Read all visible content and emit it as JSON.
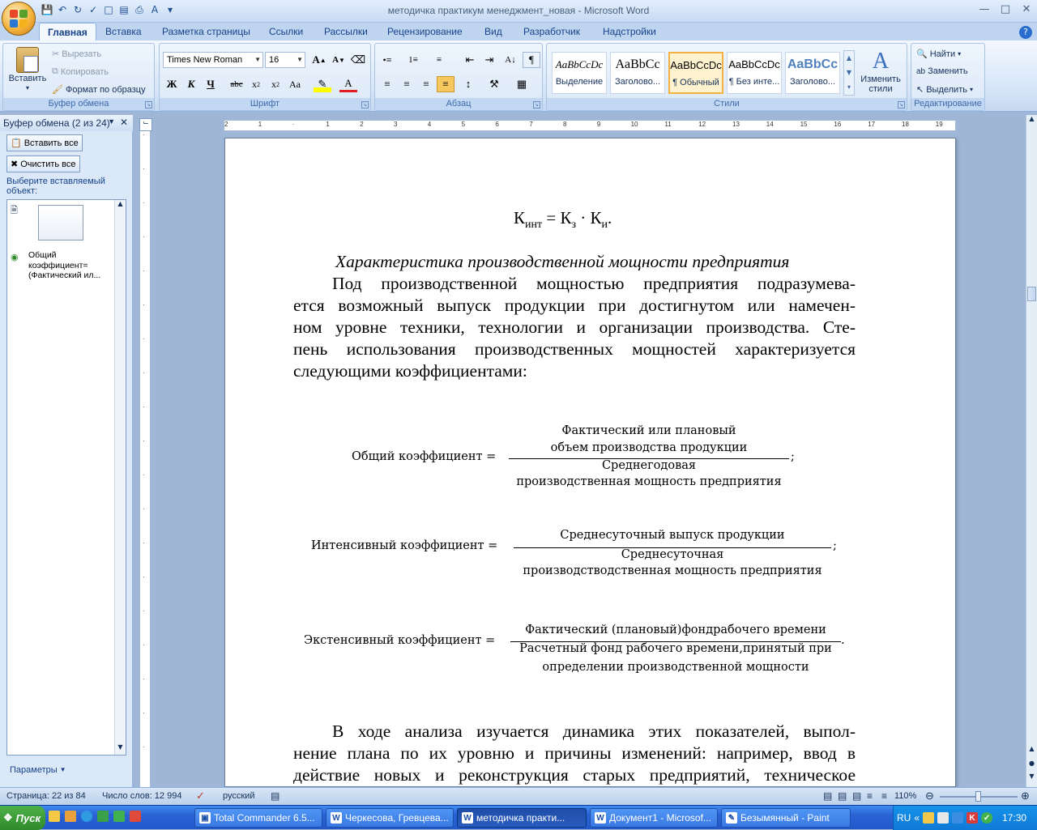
{
  "window": {
    "title": "методичка практикум менеджмент_новая - Microsoft Word"
  },
  "tabs": [
    "Главная",
    "Вставка",
    "Разметка страницы",
    "Ссылки",
    "Рассылки",
    "Рецензирование",
    "Вид",
    "Разработчик",
    "Надстройки"
  ],
  "ribbon": {
    "clipboard": {
      "label": "Буфер обмена",
      "paste": "Вставить",
      "cut": "Вырезать",
      "copy": "Копировать",
      "format_painter": "Формат по образцу"
    },
    "font": {
      "label": "Шрифт",
      "font_name": "Times New Roman",
      "font_size": "16"
    },
    "paragraph": {
      "label": "Абзац"
    },
    "styles": {
      "label": "Стили",
      "items": [
        {
          "preview": "AaBbCcDc",
          "name": "Выделение"
        },
        {
          "preview": "AaBbCc",
          "name": "Заголово..."
        },
        {
          "preview": "AaBbCcDc",
          "name": "¶ Обычный"
        },
        {
          "preview": "AaBbCcDc",
          "name": "¶ Без инте..."
        },
        {
          "preview": "AaBbCc",
          "name": "Заголово..."
        }
      ],
      "change_styles": "Изменить стили"
    },
    "editing": {
      "label": "Редактирование",
      "find": "Найти",
      "replace": "Заменить",
      "select": "Выделить"
    }
  },
  "clipboard_pane": {
    "title": "Буфер обмена (2 из 24)",
    "paste_all": "Вставить все",
    "clear_all": "Очистить все",
    "prompt": "Выберите вставляемый объект:",
    "item_text": "Общий коэффициент= (Фактический ил...",
    "options": "Параметры"
  },
  "document": {
    "formula_top": "Кинт = Кз · Ки.",
    "heading": "Характеристика производственной мощности предприятия",
    "paragraph1_lines": [
      "Под производственной мощностью предприятия подразумева-",
      "ется возможный выпуск продукции при достигнутом или намечен-",
      "ном уровне техники, технологии и организации производства. Сте-",
      "пень использования производственных мощностей характеризуется",
      "следующими коэффициентами:"
    ],
    "f1": {
      "lhs": "Общий коэффициент =",
      "num1": "Фактический или плановый",
      "num2": "объем производства продукции",
      "den1": "Среднегодовая",
      "den2": "производственная мощность предприятия",
      "end": ";"
    },
    "f2": {
      "lhs": "Интенсивный коэффициент =",
      "num1": "Среднесуточный выпуск продукции",
      "den1": "Среднесуточная",
      "den2": "производстводственная мощность предприятия",
      "end": ";"
    },
    "f3": {
      "lhs": "Экстенсивный коэффициент =",
      "num1": "Фактический (плановый)фондрабочего времени",
      "den1": "Расчетный фонд рабочего времени,принятый при",
      "den2": "определении производственной мощности",
      "end": "."
    },
    "paragraph2_lines": [
      "В ходе анализа изучается динамика этих показателей, выпол-",
      "нение плана по их уровню и причины изменений: например, ввод в",
      "действие новых и реконструкция старых предприятий, техническое"
    ]
  },
  "status": {
    "page": "Страница: 22 из 84",
    "words": "Число слов: 12 994",
    "language": "русский",
    "zoom": "110%"
  },
  "taskbar": {
    "start": "Пуск",
    "tasks": [
      "Total Commander 6.5...",
      "Черкесова, Гревцева...",
      "методичка практи...",
      "Документ1 - Microsof...",
      "Безымянный - Paint"
    ],
    "lang": "RU",
    "clock": "17:30"
  }
}
